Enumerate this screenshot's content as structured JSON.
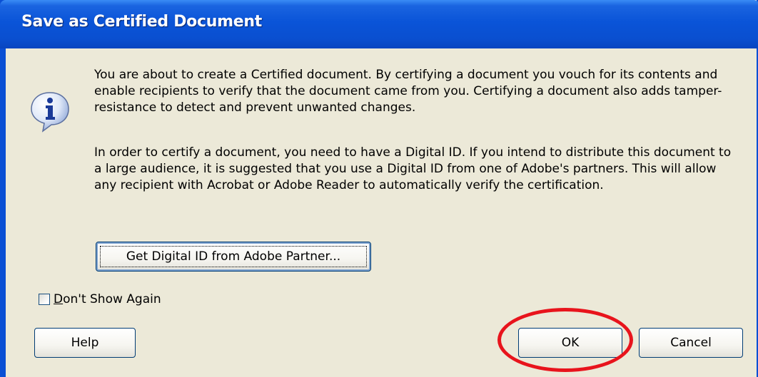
{
  "dialog": {
    "title": "Save as Certified Document",
    "icon": "information-icon",
    "message_paragraph_1": "You are about to create a Certified document. By certifying a document you vouch for its contents and enable recipients to verify that the document came from you. Certifying a document also adds tamper-resistance to detect and prevent unwanted changes.",
    "message_paragraph_2": "In order to certify a document, you need to have a Digital ID. If you intend to distribute this document to a large audience, it is suggested that you use a Digital ID from one of Adobe's partners. This will allow any recipient with Acrobat or Adobe Reader to automatically verify the certification.",
    "partner_button_label": "Get Digital ID from Adobe Partner...",
    "checkbox": {
      "label_prefix": "D",
      "label_rest": "on't Show Again",
      "checked": false
    },
    "buttons": {
      "help": "Help",
      "ok": "OK",
      "cancel": "Cancel"
    }
  },
  "annotation": {
    "highlight_color": "#e8141c",
    "highlight_target": "ok-button"
  },
  "colors": {
    "titlebar": "#0a54d8",
    "dialog_background": "#ece9d8",
    "button_border": "#003c74"
  }
}
